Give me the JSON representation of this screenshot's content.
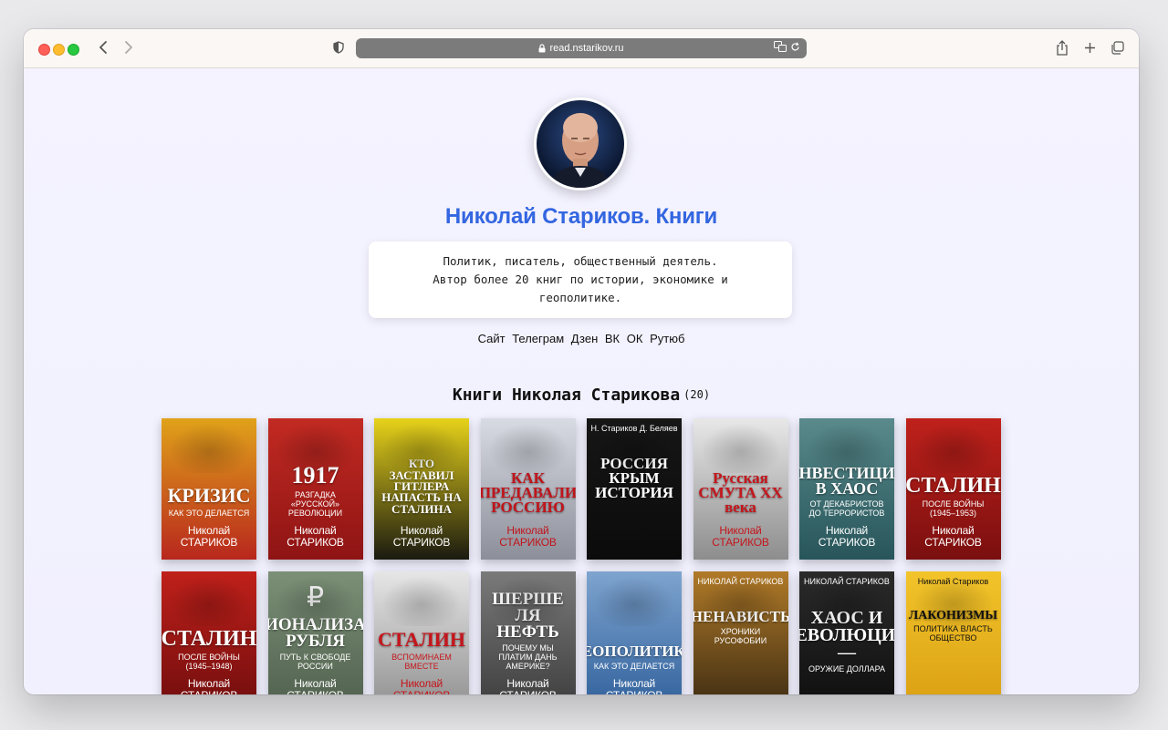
{
  "browser": {
    "url": "read.nstarikov.ru"
  },
  "profile": {
    "title": "Николай Стариков. Книги",
    "bio_lines": [
      "Политик, писатель, общественный деятель.",
      "Автор более 20 книг по истории, экономике и",
      "геополитике."
    ],
    "links": [
      "Сайт",
      "Телеграм",
      "Дзен",
      "ВК",
      "ОК",
      "Рутюб"
    ]
  },
  "books_section": {
    "heading": "Книги Николая Старикова",
    "count": "(20)"
  },
  "books": [
    {
      "top": "",
      "title": "КРИЗИС",
      "sub": "КАК ЭТО ДЕЛАЕТСЯ",
      "author1": "Николай",
      "author2": "СТАРИКОВ",
      "bg": "#b8271d",
      "bg2": "#e0a21a",
      "fg": "#ffffff"
    },
    {
      "top": "",
      "title": "1917",
      "sub": "РАЗГАДКА «РУССКОЙ» РЕВОЛЮЦИИ",
      "author1": "Николай",
      "author2": "СТАРИКОВ",
      "bg": "#8e1414",
      "bg2": "#c22a22",
      "fg": "#ffffff"
    },
    {
      "top": "",
      "title": "КТО ЗАСТАВИЛ ГИТЛЕРА НАПАСТЬ НА СТАЛИНА",
      "sub": "",
      "author1": "Николай",
      "author2": "СТАРИКОВ",
      "bg": "#1a1a10",
      "bg2": "#e7d21a",
      "fg": "#ffffff"
    },
    {
      "top": "",
      "title": "КАК ПРЕДАВАЛИ РОССИЮ",
      "sub": "",
      "author1": "Николай",
      "author2": "СТАРИКОВ",
      "bg": "#8c8f99",
      "bg2": "#d8dbe3",
      "fg": "#c0141b"
    },
    {
      "top": "Н. Стариков Д. Беляев",
      "title": "РОССИЯ КРЫМ ИСТОРИЯ",
      "sub": "",
      "author1": "",
      "author2": "",
      "bg": "#0b0b0b",
      "bg2": "#161616",
      "fg": "#ffffff"
    },
    {
      "top": "",
      "title": "Русская СМУТА XX века",
      "sub": "",
      "author1": "Николай",
      "author2": "СТАРИКОВ",
      "bg": "#8d8d8d",
      "bg2": "#e8e8e8",
      "fg": "#c4161c"
    },
    {
      "top": "",
      "title": "ИНВЕСТИЦИИ В ХАОС",
      "sub": "ОТ ДЕКАБРИСТОВ ДО ТЕРРОРИСТОВ",
      "author1": "Николай",
      "author2": "СТАРИКОВ",
      "bg": "#27555a",
      "bg2": "#5a8a8c",
      "fg": "#ffffff"
    },
    {
      "top": "",
      "title": "СТАЛИН",
      "sub": "ПОСЛЕ ВОЙНЫ (1945–1953)",
      "author1": "Николай",
      "author2": "СТАРИКОВ",
      "bg": "#7a0f0f",
      "bg2": "#c0211b",
      "fg": "#ffffff"
    },
    {
      "top": "",
      "title": "СТАЛИН",
      "sub": "ПОСЛЕ ВОЙНЫ (1945–1948)",
      "author1": "Николай",
      "author2": "СТАРИКОВ",
      "bg": "#6e0d0d",
      "bg2": "#c0201a",
      "fg": "#ffffff"
    },
    {
      "top": "₽",
      "title": "НАЦИОНАЛИЗАЦИЯ РУБЛЯ",
      "sub": "ПУТЬ К СВОБОДЕ РОССИИ",
      "author1": "Николай",
      "author2": "СТАРИКОВ",
      "bg": "#4f5f4c",
      "bg2": "#7b9077",
      "fg": "#ffffff"
    },
    {
      "top": "",
      "title": "СТАЛИН",
      "sub": "ВСПОМИНАЕМ ВМЕСТЕ",
      "author1": "Николай",
      "author2": "СТАРИКОВ",
      "bg": "#8e8e8e",
      "bg2": "#e6e6e6",
      "fg": "#c4161c"
    },
    {
      "top": "",
      "title": "ШЕРШЕ ЛЯ НЕФТЬ",
      "sub": "ПОЧЕМУ МЫ ПЛАТИМ ДАНЬ АМЕРИКЕ?",
      "author1": "Николай",
      "author2": "СТАРИКОВ",
      "bg": "#3c3c3c",
      "bg2": "#7a7a7a",
      "fg": "#ffffff"
    },
    {
      "top": "",
      "title": "ГЕОПОЛИТИКА",
      "sub": "КАК ЭТО ДЕЛАЕТСЯ",
      "author1": "Николай",
      "author2": "СТАРИКОВ",
      "bg": "#2f5f9a",
      "bg2": "#7ea4cf",
      "fg": "#ffffff"
    },
    {
      "top": "НИКОЛАЙ СТАРИКОВ",
      "title": "НЕНАВИСТЬ",
      "sub": "ХРОНИКИ РУСОФОБИИ",
      "author1": "",
      "author2": "",
      "bg": "#3b2a12",
      "bg2": "#b07a28",
      "fg": "#ffffff"
    },
    {
      "top": "НИКОЛАЙ СТАРИКОВ",
      "title": "ХАОС И РЕВОЛЮЦИИ —",
      "sub": "ОРУЖИЕ ДОЛЛАРА",
      "author1": "",
      "author2": "",
      "bg": "#0e0e0e",
      "bg2": "#2a2a2a",
      "fg": "#ffffff"
    },
    {
      "top": "Николай Стариков",
      "title": "ЛАКОНИЗМЫ",
      "sub": "ПОЛИТИКА ВЛАСТЬ ОБЩЕСТВО",
      "author1": "",
      "author2": "",
      "bg": "#d99e12",
      "bg2": "#f2c42a",
      "fg": "#111111"
    }
  ]
}
